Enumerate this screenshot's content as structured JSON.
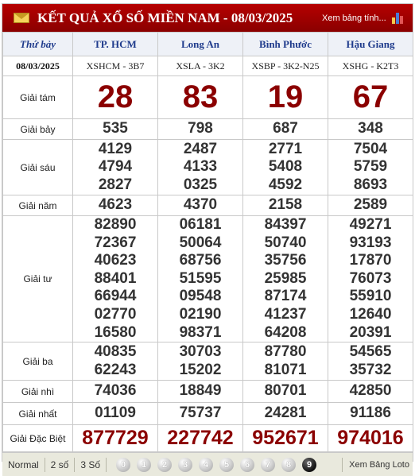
{
  "header": {
    "title": "KẾT QUẢ XỔ SỐ MIỀN NAM - 08/03/2025",
    "link_label": "Xem bảng tính..."
  },
  "table": {
    "day": "Thứ bảy",
    "date": "08/03/2025",
    "provinces": [
      {
        "name": "TP. HCM",
        "code": "XSHCM - 3B7"
      },
      {
        "name": "Long An",
        "code": "XSLA - 3K2"
      },
      {
        "name": "Bình Phước",
        "code": "XSBP - 3K2-N25"
      },
      {
        "name": "Hậu Giang",
        "code": "XSHG - K2T3"
      }
    ],
    "prizes": [
      {
        "label": "Giải tám",
        "values": [
          [
            "28"
          ],
          [
            "83"
          ],
          [
            "19"
          ],
          [
            "67"
          ]
        ]
      },
      {
        "label": "Giải bảy",
        "values": [
          [
            "535"
          ],
          [
            "798"
          ],
          [
            "687"
          ],
          [
            "348"
          ]
        ]
      },
      {
        "label": "Giải sáu",
        "values": [
          [
            "4129",
            "4794",
            "2827"
          ],
          [
            "2487",
            "4133",
            "0325"
          ],
          [
            "2771",
            "5408",
            "4592"
          ],
          [
            "7504",
            "5759",
            "8693"
          ]
        ]
      },
      {
        "label": "Giải năm",
        "values": [
          [
            "4623"
          ],
          [
            "4370"
          ],
          [
            "2158"
          ],
          [
            "2589"
          ]
        ]
      },
      {
        "label": "Giải tư",
        "values": [
          [
            "82890",
            "72367",
            "40623",
            "88401",
            "66944",
            "02770",
            "16580"
          ],
          [
            "06181",
            "50064",
            "68756",
            "51595",
            "09548",
            "02190",
            "98371"
          ],
          [
            "84397",
            "50740",
            "35756",
            "25985",
            "87174",
            "41237",
            "64208"
          ],
          [
            "49271",
            "93193",
            "17870",
            "76073",
            "55910",
            "12640",
            "20391"
          ]
        ]
      },
      {
        "label": "Giải ba",
        "values": [
          [
            "40835",
            "62243"
          ],
          [
            "30703",
            "15202"
          ],
          [
            "87780",
            "81071"
          ],
          [
            "54565",
            "35732"
          ]
        ]
      },
      {
        "label": "Giải nhì",
        "values": [
          [
            "74036"
          ],
          [
            "18849"
          ],
          [
            "80701"
          ],
          [
            "42850"
          ]
        ]
      },
      {
        "label": "Giải nhất",
        "values": [
          [
            "01109"
          ],
          [
            "75737"
          ],
          [
            "24281"
          ],
          [
            "91186"
          ]
        ]
      },
      {
        "label": "Giải Đặc Biệt",
        "values": [
          [
            "877729"
          ],
          [
            "227742"
          ],
          [
            "952671"
          ],
          [
            "974016"
          ]
        ]
      }
    ]
  },
  "footer": {
    "options": [
      "Normal",
      "2 số",
      "3 Số"
    ],
    "digits": [
      "0",
      "1",
      "2",
      "3",
      "4",
      "5",
      "6",
      "7",
      "8",
      "9"
    ],
    "loto_label": "Xem Bảng Loto"
  },
  "colors": {
    "header_bg": "#a00000",
    "prize_red": "#8b0000",
    "province_blue": "#1f3b8c",
    "footer_bg": "#e9e9dd"
  }
}
